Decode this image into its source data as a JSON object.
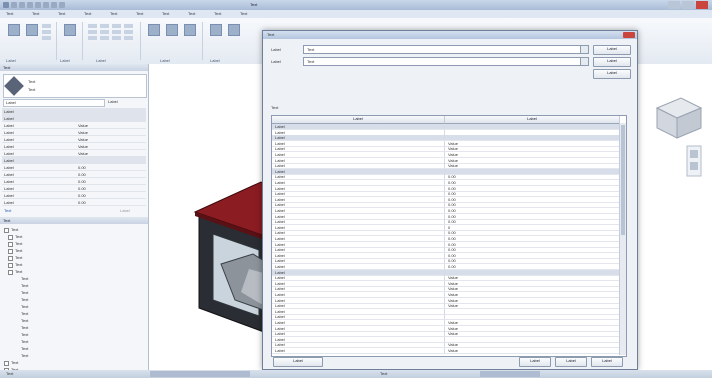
{
  "app": {
    "title": "Text",
    "window_controls": [
      "",
      "",
      ""
    ]
  },
  "menu": {
    "items": [
      "Text",
      "Text",
      "Text",
      "Text",
      "Text",
      "Text",
      "Text",
      "Text",
      "Text",
      "Text"
    ]
  },
  "ribbon": {
    "groups": [
      "Label",
      "Label",
      "Label",
      "Label",
      "Label"
    ],
    "buttons": [
      "",
      "",
      "",
      "",
      "",
      "",
      "",
      "",
      "",
      "",
      "",
      ""
    ]
  },
  "properties": {
    "panel_title": "Text",
    "type_name": "Text",
    "type_subname": "Text",
    "filter_label": "Label",
    "edit_type_label": "Label",
    "rows": [
      {
        "k": "Label",
        "v": ""
      },
      {
        "k": "Label",
        "v": "",
        "section": true
      },
      {
        "k": "Label",
        "v": "Value"
      },
      {
        "k": "Label",
        "v": "Value"
      },
      {
        "k": "Label",
        "v": "Value"
      },
      {
        "k": "Label",
        "v": "Value"
      },
      {
        "k": "Label",
        "v": "Value"
      },
      {
        "k": "Label",
        "v": "",
        "section": true
      },
      {
        "k": "Label",
        "v": "0.00"
      },
      {
        "k": "Label",
        "v": "0.00"
      },
      {
        "k": "Label",
        "v": "0.00"
      },
      {
        "k": "Label",
        "v": "0.00"
      },
      {
        "k": "Label",
        "v": "0.00"
      },
      {
        "k": "Label",
        "v": "0.00"
      }
    ],
    "help_link": "Text",
    "apply_label": "Label"
  },
  "browser": {
    "panel_title": "Text",
    "items": [
      "Text",
      "Text",
      "Text",
      "Text",
      "Text",
      "Text",
      "Text",
      "Text",
      "Text",
      "Text",
      "Text",
      "Text",
      "Text",
      "Text",
      "Text",
      "Text",
      "Text",
      "Text",
      "Text",
      "Text",
      "Text"
    ]
  },
  "dialog": {
    "title": "Text",
    "family_label": "Label",
    "family_value": "Text",
    "type_label": "Label",
    "type_value": "Text",
    "load_button": "Label",
    "duplicate_button": "Label",
    "rename_button": "Label",
    "type_params_label": "Text",
    "col_param": "Label",
    "col_value": "Label",
    "rows": [
      {
        "k": "Label",
        "v": "",
        "group": true
      },
      {
        "k": "Label",
        "v": ""
      },
      {
        "k": "Label",
        "v": "",
        "group": true
      },
      {
        "k": "Label",
        "v": "Value"
      },
      {
        "k": "Label",
        "v": "Value"
      },
      {
        "k": "Label",
        "v": "Value"
      },
      {
        "k": "Label",
        "v": "Value"
      },
      {
        "k": "Label",
        "v": "Value"
      },
      {
        "k": "Label",
        "v": "",
        "group": true
      },
      {
        "k": "Label",
        "v": "0.00"
      },
      {
        "k": "Label",
        "v": "0.00"
      },
      {
        "k": "Label",
        "v": "0.00"
      },
      {
        "k": "Label",
        "v": "0.00"
      },
      {
        "k": "Label",
        "v": "0.00"
      },
      {
        "k": "Label",
        "v": "0.00"
      },
      {
        "k": "Label",
        "v": "0.00"
      },
      {
        "k": "Label",
        "v": "0.00"
      },
      {
        "k": "Label",
        "v": "0.00"
      },
      {
        "k": "Label",
        "v": "0"
      },
      {
        "k": "Label",
        "v": "0.00"
      },
      {
        "k": "Label",
        "v": "0.00"
      },
      {
        "k": "Label",
        "v": "0.00"
      },
      {
        "k": "Label",
        "v": "0.00"
      },
      {
        "k": "Label",
        "v": "0.00"
      },
      {
        "k": "Label",
        "v": "0.00"
      },
      {
        "k": "Label",
        "v": "0.00"
      },
      {
        "k": "Label",
        "v": "",
        "group": true
      },
      {
        "k": "Label",
        "v": "Value"
      },
      {
        "k": "Label",
        "v": "Value"
      },
      {
        "k": "Label",
        "v": "Value"
      },
      {
        "k": "Label",
        "v": "Value"
      },
      {
        "k": "Label",
        "v": "Value"
      },
      {
        "k": "Label",
        "v": "Value"
      },
      {
        "k": "Label",
        "v": ""
      },
      {
        "k": "Label",
        "v": ""
      },
      {
        "k": "Label",
        "v": "Value"
      },
      {
        "k": "Label",
        "v": "Value"
      },
      {
        "k": "Label",
        "v": "Value"
      },
      {
        "k": "Label",
        "v": ""
      },
      {
        "k": "Label",
        "v": "Value"
      },
      {
        "k": "Label",
        "v": "Value"
      }
    ],
    "preview_button": "Label",
    "ok_button": "Label",
    "cancel_button": "Label",
    "apply_button": "Label"
  },
  "status": {
    "scale": "Text",
    "coords": "Text"
  },
  "colors": {
    "roof": "#8b1c22",
    "accent": "#c9453d"
  }
}
